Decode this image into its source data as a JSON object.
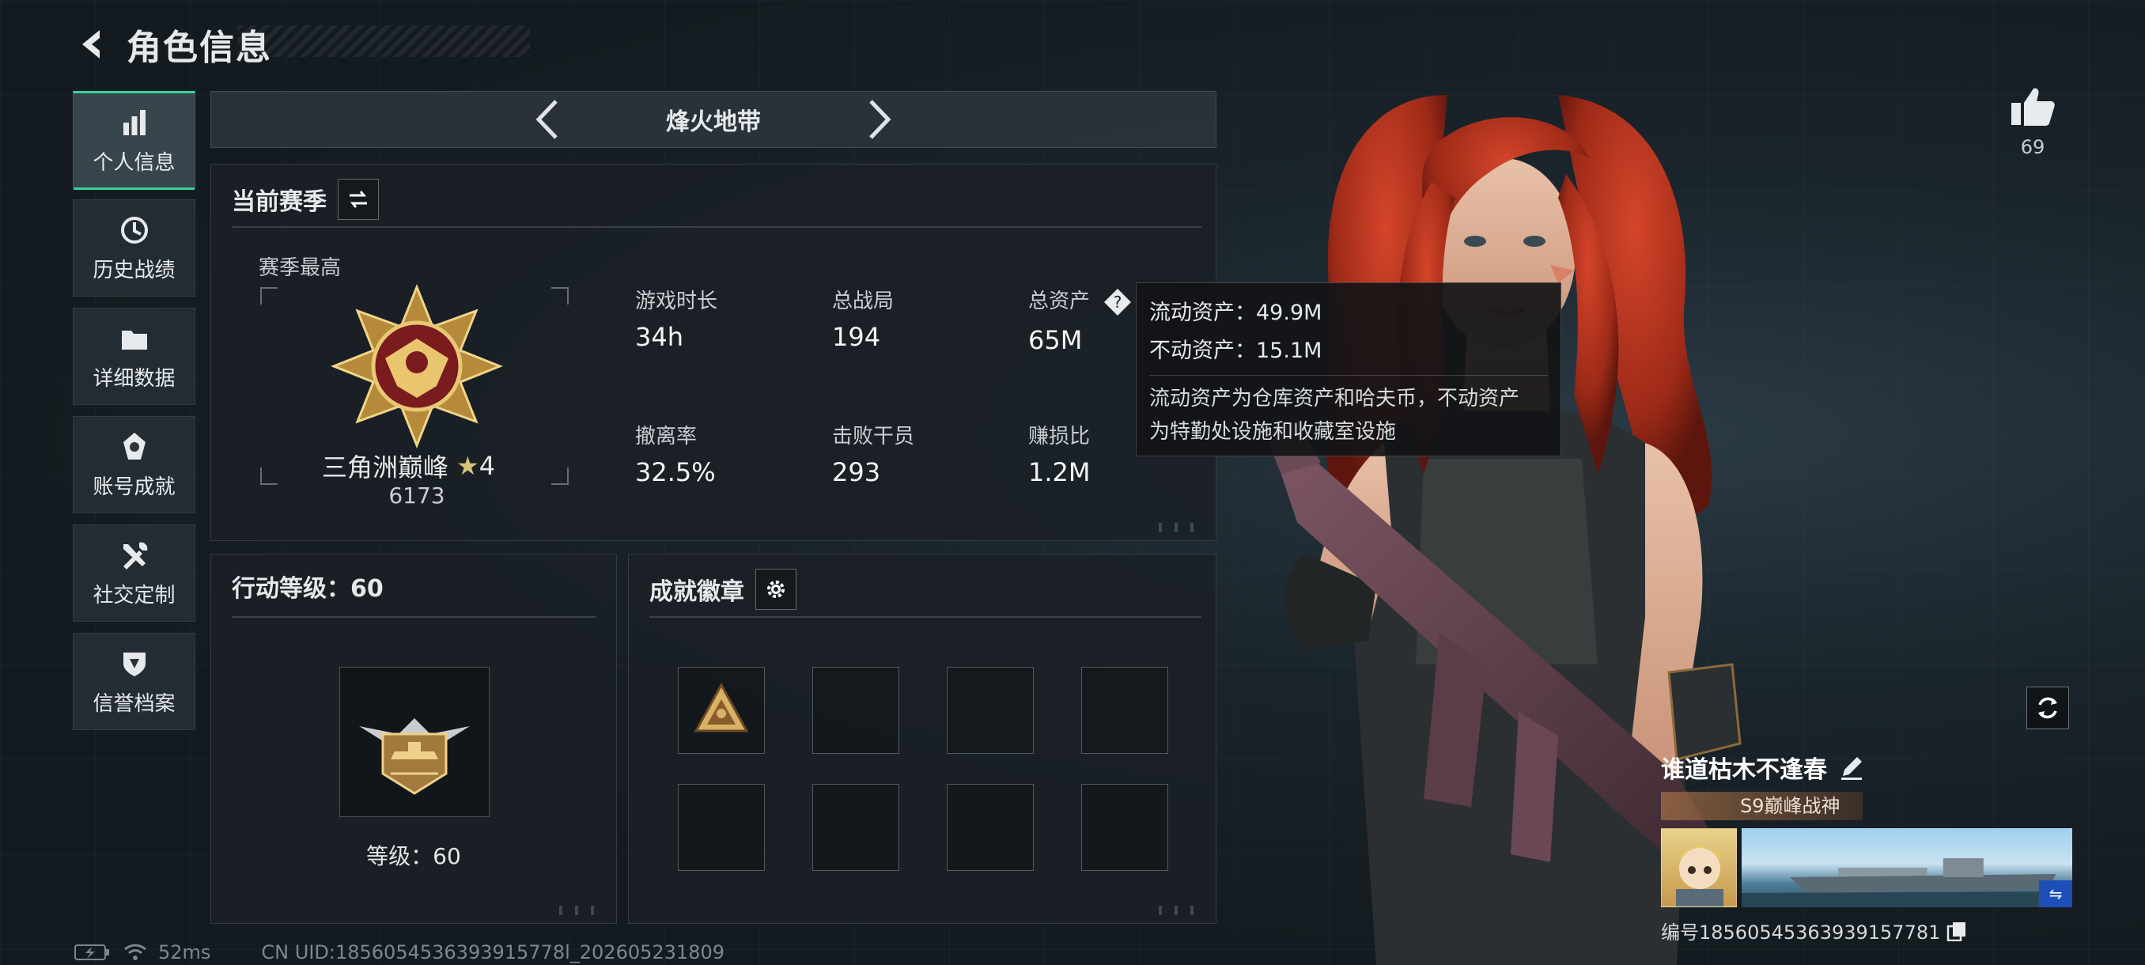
{
  "header": {
    "title": "角色信息"
  },
  "sidebar": {
    "items": [
      {
        "label": "个人信息",
        "icon": "bar-chart-icon",
        "active": true
      },
      {
        "label": "历史战绩",
        "icon": "history-icon",
        "active": false
      },
      {
        "label": "详细数据",
        "icon": "folder-icon",
        "active": false
      },
      {
        "label": "账号成就",
        "icon": "achievement-icon",
        "active": false
      },
      {
        "label": "社交定制",
        "icon": "tools-icon",
        "active": false
      },
      {
        "label": "信誉档案",
        "icon": "credit-shield-icon",
        "active": false
      }
    ]
  },
  "mode": {
    "title": "烽火地带"
  },
  "season": {
    "title": "当前赛季",
    "best_label": "赛季最高",
    "rank_name": "三角洲巅峰",
    "rank_stars": "4",
    "rank_score": "6173",
    "stats": [
      {
        "label": "游戏时长",
        "value": "34h"
      },
      {
        "label": "总战局",
        "value": "194"
      },
      {
        "label": "总资产",
        "value": "65M"
      },
      {
        "label": "撤离率",
        "value": "32.5%"
      },
      {
        "label": "击败干员",
        "value": "293"
      },
      {
        "label": "赚损比",
        "value": "1.2M"
      }
    ]
  },
  "tooltip": {
    "liquid": "流动资产：49.9M",
    "fixed": "不动资产：15.1M",
    "note_line1": "流动资产为仓库资产和哈夫币，不动资产",
    "note_line2": "为特勤处设施和收藏室设施"
  },
  "action_level": {
    "title": "行动等级：60",
    "level_text": "等级：60"
  },
  "achievements": {
    "title": "成就徽章"
  },
  "status": {
    "ping": "52ms",
    "uid": "CN UID:1856054536393915778l_202605231809"
  },
  "right": {
    "likes": "69",
    "player_name": "谁道枯木不逢春",
    "player_title": "S9巅峰战神",
    "player_id": "编号18560545363939157781"
  },
  "colors": {
    "accent": "#37d39a",
    "panel": "#1a2026",
    "gold": "#d9c27a"
  }
}
